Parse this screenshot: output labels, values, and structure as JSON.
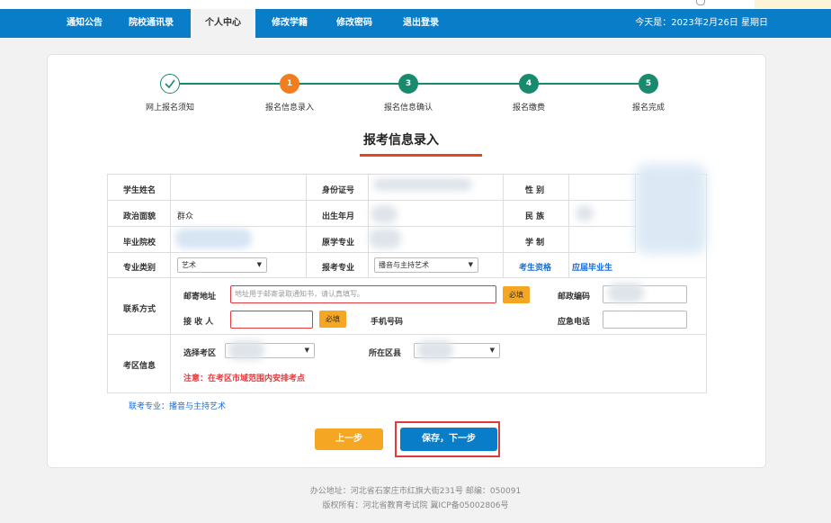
{
  "nav": {
    "items": [
      "通知公告",
      "院校通讯录",
      "个人中心",
      "修改学籍",
      "修改密码",
      "退出登录"
    ],
    "active": "个人中心",
    "date": "今天是：2023年2月26日 星期日"
  },
  "steps": [
    {
      "label": "网上报名须知",
      "num": "✓",
      "state": "done"
    },
    {
      "label": "报名信息录入",
      "num": "1",
      "state": "current"
    },
    {
      "label": "报名信息确认",
      "num": "3",
      "state": "todo"
    },
    {
      "label": "报名缴费",
      "num": "4",
      "state": "todo"
    },
    {
      "label": "报名完成",
      "num": "5",
      "state": "todo"
    }
  ],
  "title": "报考信息录入",
  "form": {
    "student_name_label": "学生姓名",
    "id_label": "身份证号",
    "gender_label": "性  别",
    "political_label": "政治面貌",
    "political_value": "群众",
    "birth_label": "出生年月",
    "ethnic_label": "民  族",
    "school_label": "毕业院校",
    "major_orig_label": "原学专业",
    "system_label": "学  制",
    "major_cat_label": "专业类别",
    "major_cat_value": "艺术",
    "apply_major_label": "报考专业",
    "apply_major_value": "播音与主持艺术",
    "qualification_label": "考生资格",
    "qualification_value": "应届毕业生",
    "contact_label": "联系方式",
    "address_label": "邮寄地址",
    "address_placeholder": "地址用于邮寄录取通知书，请认真填写。",
    "required_btn": "必填",
    "postcode_label": "邮政编码",
    "receiver_label": "接 收 人",
    "phone_label": "手机号码",
    "emergency_label": "应急电话",
    "exam_area_label": "考区信息",
    "select_area_label": "选择考区",
    "district_label": "所在区县",
    "area_note": "注意：在考区市域范围内安排考点"
  },
  "united_major": "联考专业：播音与主持艺术",
  "buttons": {
    "prev": "上一步",
    "next": "保存，下一步"
  },
  "footer": {
    "address": "办公地址：河北省石家庄市红旗大街231号    邮编：050091",
    "copyright": "版权所有：河北省教育考试院 冀ICP备05002806号"
  },
  "colors": {
    "nav": "#0a7dc8",
    "accent": "#f07d1e",
    "step": "#1a8a6e",
    "required": "#f5a623",
    "error": "#e4393c"
  }
}
